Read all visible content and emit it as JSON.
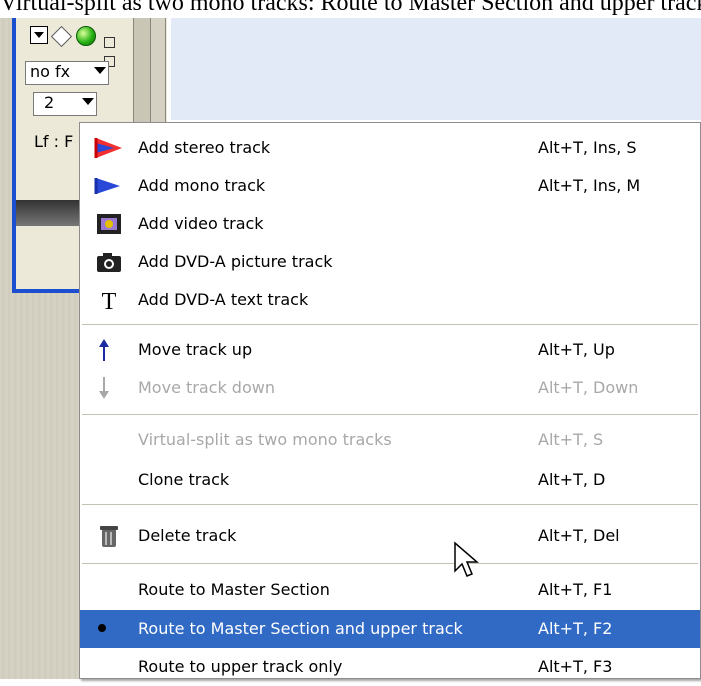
{
  "caption": "Virtual-split as two mono tracks: Route to Master Section and upper track",
  "track_panel": {
    "fx_select": "no fx",
    "number_select": "2",
    "lf_label": "Lf : F"
  },
  "menu": {
    "items": [
      {
        "label": "Add stereo track",
        "shortcut": "Alt+T, Ins, S",
        "icon": "stereo-waveform-icon",
        "enabled": true
      },
      {
        "label": "Add mono track",
        "shortcut": "Alt+T, Ins, M",
        "icon": "mono-waveform-icon",
        "enabled": true
      },
      {
        "label": "Add video track",
        "shortcut": "",
        "icon": "film-icon",
        "enabled": true
      },
      {
        "label": "Add DVD-A picture track",
        "shortcut": "",
        "icon": "camera-icon",
        "enabled": true
      },
      {
        "label": "Add DVD-A text track",
        "shortcut": "",
        "icon": "text-t-icon",
        "enabled": true
      },
      {
        "label": "Move track up",
        "shortcut": "Alt+T, Up",
        "icon": "arrow-up-icon",
        "enabled": true
      },
      {
        "label": "Move track down",
        "shortcut": "Alt+T, Down",
        "icon": "arrow-down-icon",
        "enabled": false
      },
      {
        "label": "Virtual-split as two mono tracks",
        "shortcut": "Alt+T, S",
        "icon": "",
        "enabled": false
      },
      {
        "label": "Clone track",
        "shortcut": "Alt+T, D",
        "icon": "",
        "enabled": true
      },
      {
        "label": "Delete track",
        "shortcut": "Alt+T, Del",
        "icon": "trash-can-icon",
        "enabled": true
      },
      {
        "label": "Route to Master Section",
        "shortcut": "Alt+T, F1",
        "icon": "",
        "enabled": true
      },
      {
        "label": "Route to Master Section and upper track",
        "shortcut": "Alt+T, F2",
        "icon": "bullet-icon",
        "enabled": true,
        "highlighted": true
      },
      {
        "label": "Route to upper track only",
        "shortcut": "Alt+T, F3",
        "icon": "",
        "enabled": true
      }
    ]
  },
  "colors": {
    "highlight": "#316ac5",
    "disabled_text": "#a8a8a8",
    "panel_border": "#1c4fd0"
  }
}
